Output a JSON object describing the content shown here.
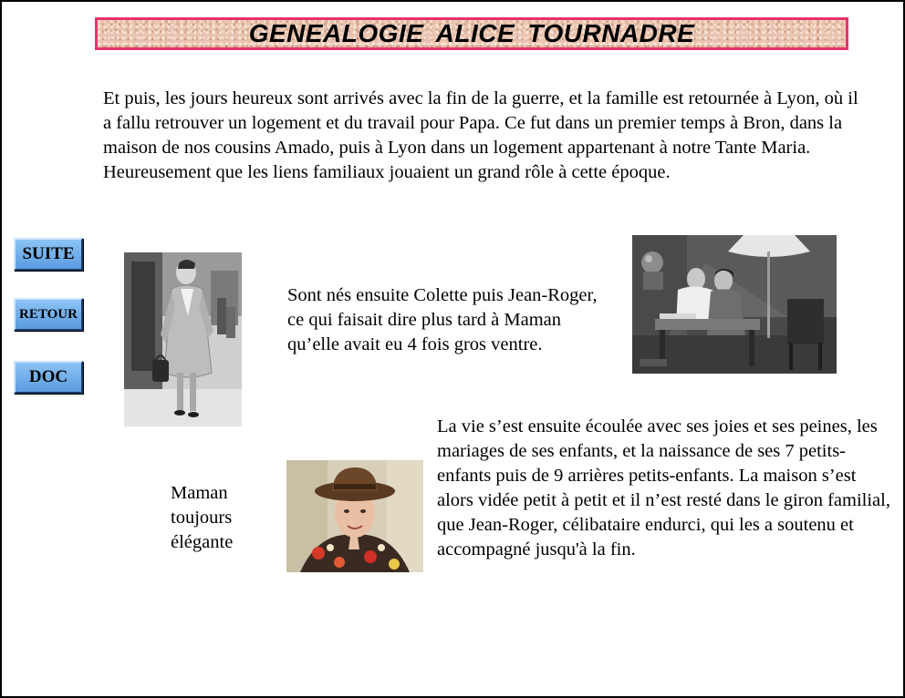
{
  "header": {
    "title": "GENEALOGIE  ALICE  TOURNADRE"
  },
  "intro": {
    "text": "Et puis, les jours heureux sont arrivés avec la fin de la guerre, et la famille est retournée à Lyon, où il a fallu retrouver un logement et du travail pour Papa. Ce fut dans un premier temps à Bron, dans la maison de nos cousins Amado, puis à Lyon dans un logement appartenant à notre Tante Maria. Heureusement que les liens familiaux jouaient un grand rôle à cette époque."
  },
  "nav": {
    "suite": "SUITE",
    "retour": "RETOUR",
    "doc": "DOC"
  },
  "middle": {
    "text": "Sont nés ensuite Colette puis Jean-Roger, ce qui faisait dire plus tard à Maman qu’elle avait eu 4 fois gros ventre."
  },
  "lower": {
    "text": "La vie s’est ensuite écoulée avec ses joies et ses peines, les mariages de ses enfants, et la naissance de ses 7 petits-enfants puis de 9 arrières petits-enfants. La maison s’est alors vidée petit à petit et il n’est resté dans le giron familial, que Jean-Roger, célibataire endurci, qui les a soutenu et accompagné jusqu'à la fin."
  },
  "caption": {
    "line1": "Maman",
    "line2": "toujours",
    "line3": "élégante"
  }
}
